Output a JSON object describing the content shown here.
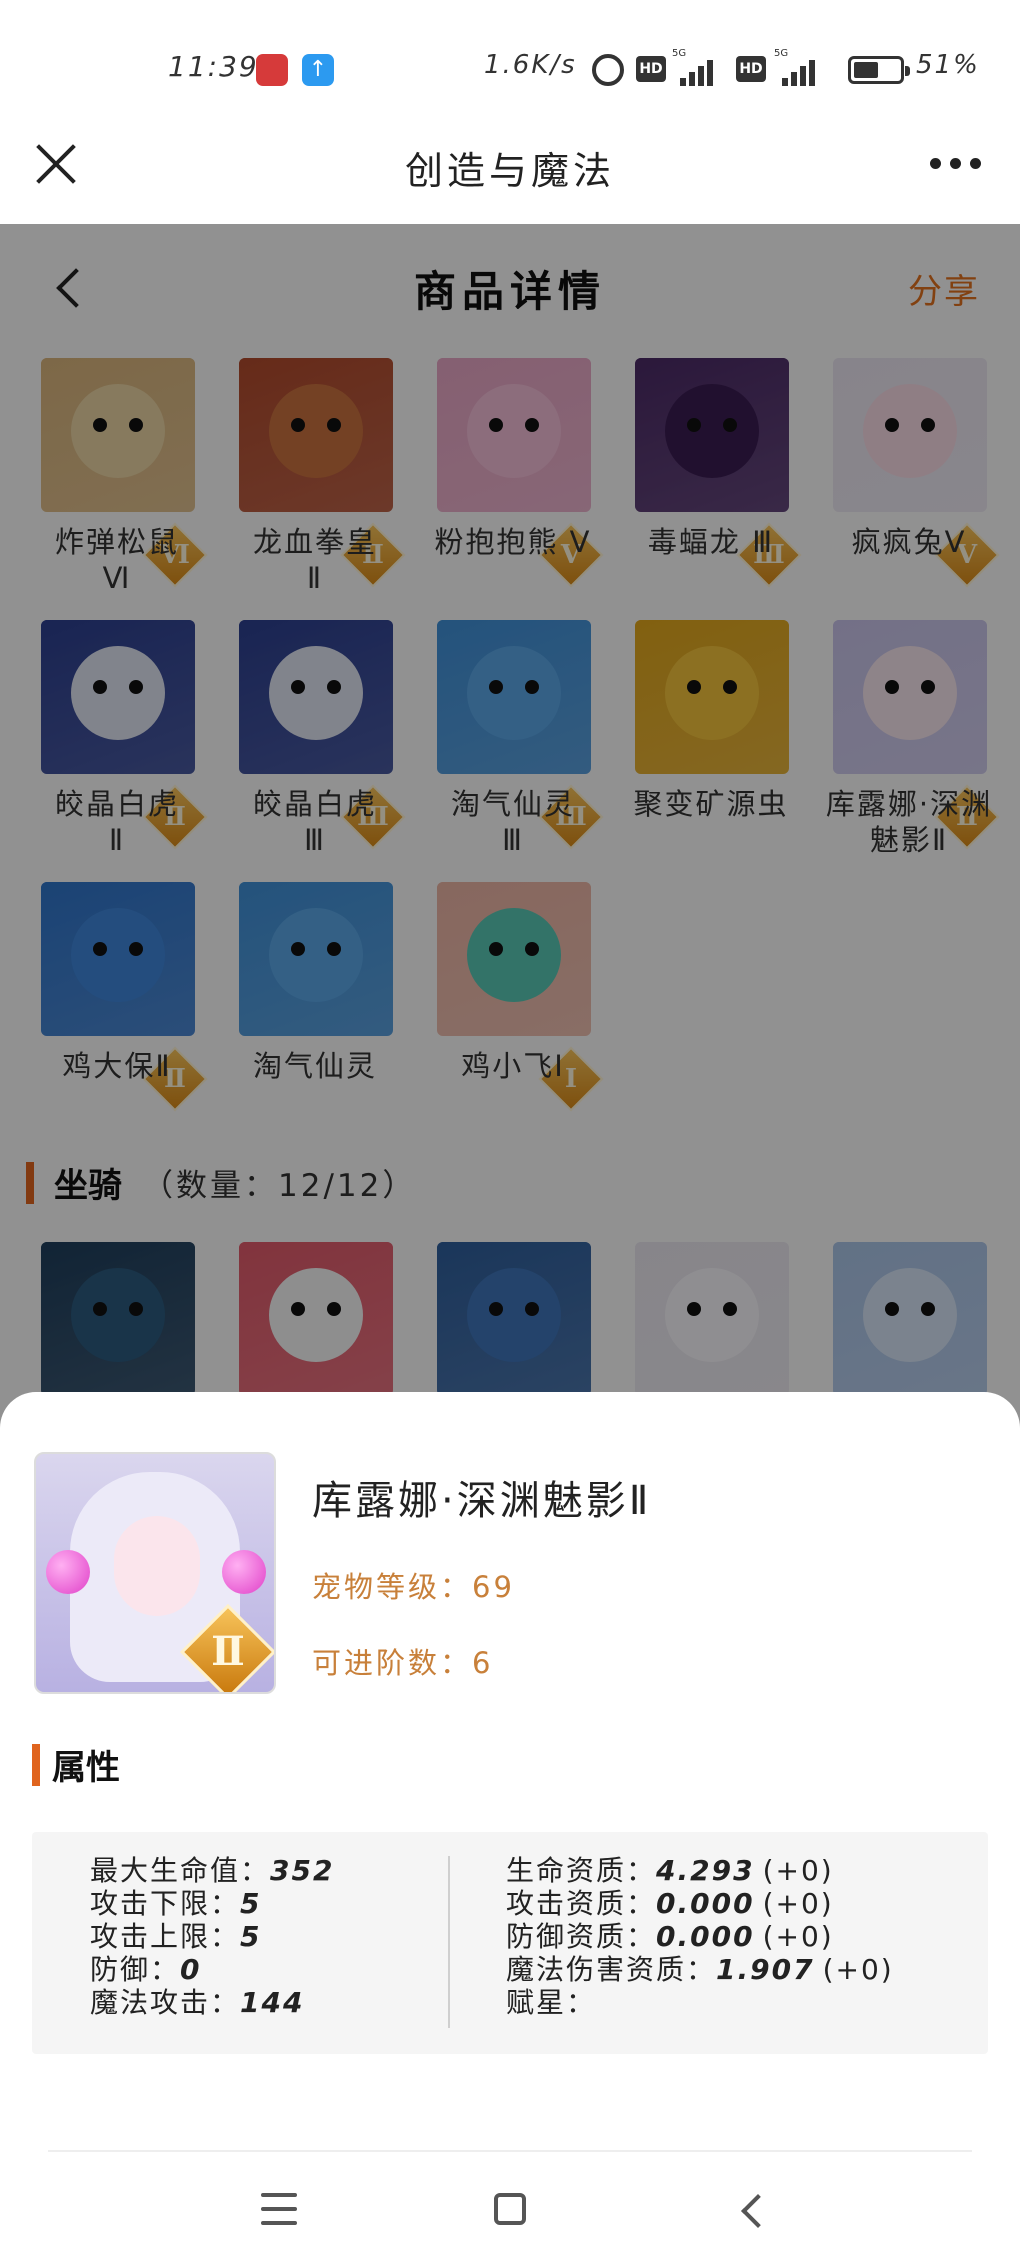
{
  "status_bar": {
    "time": "11:39",
    "net_speed": "1.6K/s",
    "battery_pct": "51%",
    "hd1": "HD",
    "hd2": "HD",
    "net1": "5G",
    "net2": "5G",
    "app2_icon": "↑"
  },
  "app_bar": {
    "title": "创造与魔法"
  },
  "sub_header": {
    "title": "商品详情",
    "share": "分享"
  },
  "pets": [
    {
      "name": "炸弹松鼠\nⅥ",
      "rank": "Ⅵ",
      "color": "#d8b47c",
      "head": "#e8d2a2"
    },
    {
      "name": "龙血拳皇\nⅡ",
      "rank": "Ⅱ",
      "color": "#b04a2c",
      "head": "#c9713e"
    },
    {
      "name": "粉抱抱熊 Ⅴ",
      "rank": "Ⅴ",
      "color": "#e6a5c4",
      "head": "#f2bcd6"
    },
    {
      "name": "毒蝠龙 Ⅲ",
      "rank": "Ⅲ",
      "color": "#4b2a66",
      "head": "#3a1d52"
    },
    {
      "name": "疯疯兔Ⅴ",
      "rank": "Ⅴ",
      "color": "#e9e4ef",
      "head": "#f7d9e4"
    },
    {
      "name": "皎晶白虎\nⅡ",
      "rank": "Ⅱ",
      "color": "#2c3f8f",
      "head": "#dfe4f2"
    },
    {
      "name": "皎晶白虎\nⅢ",
      "rank": "Ⅲ",
      "color": "#2c3f8f",
      "head": "#dfe4f2"
    },
    {
      "name": "淘气仙灵\nⅢ",
      "rank": "Ⅲ",
      "color": "#3f8fd6",
      "head": "#5aa6e6"
    },
    {
      "name": "聚变矿源虫",
      "rank": "",
      "color": "#e0a61c",
      "head": "#f2c23c"
    },
    {
      "name": "库露娜·深渊魅影Ⅱ",
      "rank": "Ⅱ",
      "color": "#c7c2e8",
      "head": "#f4e3ec"
    },
    {
      "name": "鸡大保Ⅱ",
      "rank": "Ⅱ",
      "color": "#2f74c9",
      "head": "#3e86da"
    },
    {
      "name": "淘气仙灵",
      "rank": "",
      "color": "#3f8fd6",
      "head": "#5aa6e6"
    },
    {
      "name": "鸡小飞Ⅰ",
      "rank": "Ⅰ",
      "color": "#e9b3a3",
      "head": "#58c6b4"
    }
  ],
  "mounts_section": {
    "label": "坐骑",
    "count": "（数量：12/12）"
  },
  "mounts": [
    {
      "color": "#1e3e5c",
      "head": "#2b5a7e"
    },
    {
      "color": "#e05a6a",
      "head": "#f4f4f4"
    },
    {
      "color": "#2e5e9c",
      "head": "#3e74b8"
    },
    {
      "color": "#e9e6ee",
      "head": "#f7f5fa"
    },
    {
      "color": "#a9c3e6",
      "head": "#d4e2f4"
    }
  ],
  "detail": {
    "name": "库露娜·深渊魅影Ⅱ",
    "rank": "Ⅱ",
    "level": "宠物等级：69",
    "advance": "可进阶数：6",
    "attr_label": "属性",
    "left": [
      {
        "label": "最大生命值：",
        "value": "352"
      },
      {
        "label": "攻击下限：",
        "value": "5"
      },
      {
        "label": "攻击上限：",
        "value": "5"
      },
      {
        "label": "防御：",
        "value": "0"
      },
      {
        "label": "魔法攻击：",
        "value": "144"
      }
    ],
    "right": [
      {
        "label": "生命资质：",
        "value": "4.293",
        "inc": "(+0)"
      },
      {
        "label": "攻击资质：",
        "value": "0.000",
        "inc": "(+0)"
      },
      {
        "label": "防御资质：",
        "value": "0.000",
        "inc": "(+0)"
      },
      {
        "label": "魔法伤害资质：",
        "value": "1.907",
        "inc": "(+0)"
      },
      {
        "label": "赋星：",
        "value": "",
        "inc": ""
      }
    ]
  }
}
